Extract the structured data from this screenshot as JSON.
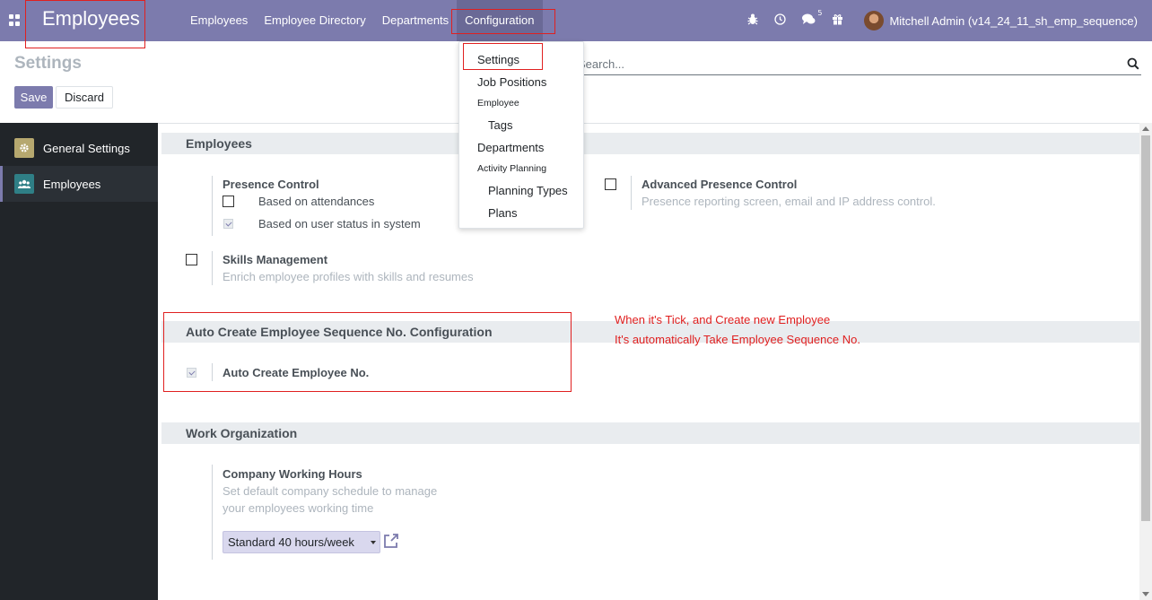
{
  "navbar": {
    "brand": "Employees",
    "menu": [
      "Employees",
      "Employee Directory",
      "Departments",
      "Configuration"
    ],
    "chat_count": "5",
    "user": "Mitchell Admin (v14_24_11_sh_emp_sequence)"
  },
  "control_panel": {
    "title": "Settings",
    "save_label": "Save",
    "discard_label": "Discard",
    "search_placeholder": "Search..."
  },
  "dropdown": {
    "settings": "Settings",
    "job_positions": "Job Positions",
    "employee_header": "Employee",
    "tags": "Tags",
    "departments": "Departments",
    "activity_header": "Activity Planning",
    "planning_types": "Planning Types",
    "plans": "Plans"
  },
  "sidebar": {
    "items": [
      "General Settings",
      "Employees"
    ]
  },
  "sections": {
    "employees": {
      "title": "Employees",
      "presence_control": "Presence Control",
      "based_on_attendances": "Based on attendances",
      "based_on_user_status": "Based on user status in system",
      "advanced_presence": "Advanced Presence Control",
      "advanced_presence_desc": "Presence reporting screen, email and IP address control.",
      "skills": "Skills Management",
      "skills_desc": "Enrich employee profiles with skills and resumes"
    },
    "auto_seq": {
      "title": "Auto Create Employee Sequence No. Configuration",
      "label": "Auto Create Employee No."
    },
    "work_org": {
      "title": "Work Organization",
      "hours_label": "Company Working Hours",
      "hours_desc_1": "Set default company schedule to manage",
      "hours_desc_2": "your employees working time",
      "hours_value": "Standard 40 hours/week"
    }
  },
  "note": {
    "line1": "When it's Tick, and Create new Employee",
    "line2": "It's automatically Take Employee Sequence No."
  },
  "colors": {
    "navbar": "#7c7bad",
    "sidebar": "#212529",
    "annotation": "#e02020"
  }
}
